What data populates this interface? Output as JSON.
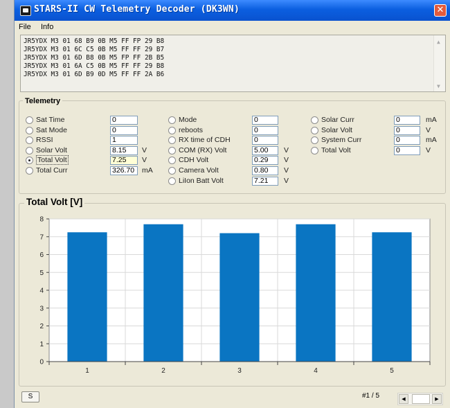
{
  "window": {
    "title": "STARS-II CW Telemetry Decoder (DK3WN)",
    "close_glyph": "✕",
    "app_icon": "cat-icon"
  },
  "menu": {
    "file": "File",
    "info": "Info"
  },
  "log_lines": [
    "JR5YDX M3 01 68 B9 0B M5 FF FP 29 B8",
    "JR5YDX M3 01 6C C5 0B M5 FF FF 29 B7",
    "JR5YDX M3 01 6D B8 0B M5 FP FF 2B B5",
    "JR5YDX M3 01 6A C5 0B M5 FF FF 29 B8",
    "JR5YDX M3 01 6D B9 0D M5 FF FF 2A B6"
  ],
  "telemetry": {
    "label": "Telemetry",
    "col1": [
      {
        "label": "Sat Time",
        "value": "0",
        "unit": "",
        "checked": false
      },
      {
        "label": "Sat Mode",
        "value": "0",
        "unit": "",
        "checked": false
      },
      {
        "label": "RSSI",
        "value": "1",
        "unit": "",
        "checked": false
      },
      {
        "label": "Solar Volt",
        "value": "8.15",
        "unit": "V",
        "checked": false
      },
      {
        "label": "Total Volt",
        "value": "7.25",
        "unit": "V",
        "checked": true
      },
      {
        "label": "Total Curr",
        "value": "326.70",
        "unit": "mA",
        "checked": false
      }
    ],
    "col2": [
      {
        "label": "Mode",
        "value": "0",
        "unit": "",
        "checked": false
      },
      {
        "label": "reboots",
        "value": "0",
        "unit": "",
        "checked": false
      },
      {
        "label": "RX time of CDH",
        "value": "0",
        "unit": "",
        "checked": false
      },
      {
        "label": "COM (RX) Volt",
        "value": "5.00",
        "unit": "V",
        "checked": false
      },
      {
        "label": "CDH Volt",
        "value": "0.29",
        "unit": "V",
        "checked": false
      },
      {
        "label": "Camera Volt",
        "value": "0.80",
        "unit": "V",
        "checked": false
      },
      {
        "label": "LiIon Batt Volt",
        "value": "7.21",
        "unit": "V",
        "checked": false
      }
    ],
    "col3": [
      {
        "label": "Solar Curr",
        "value": "0",
        "unit": "mA",
        "checked": false
      },
      {
        "label": "Solar Volt",
        "value": "0",
        "unit": "V",
        "checked": false
      },
      {
        "label": "System Curr",
        "value": "0",
        "unit": "mA",
        "checked": false
      },
      {
        "label": "Total Volt",
        "value": "0",
        "unit": "V",
        "checked": false
      }
    ]
  },
  "chart_label": "Total Volt [V]",
  "chart_data": {
    "type": "bar",
    "categories": [
      "1",
      "2",
      "3",
      "4",
      "5"
    ],
    "values": [
      7.25,
      7.7,
      7.2,
      7.7,
      7.25
    ],
    "ylim": [
      0,
      8
    ],
    "yticks": [
      "0",
      "1",
      "2",
      "3",
      "4",
      "5",
      "6",
      "7",
      "8"
    ],
    "grid": true,
    "bar_color": "#0a75c2"
  },
  "footer": {
    "s_button": "S",
    "page_indicator": "#1 / 5",
    "left_arrow": "◀",
    "right_arrow": "▶"
  }
}
